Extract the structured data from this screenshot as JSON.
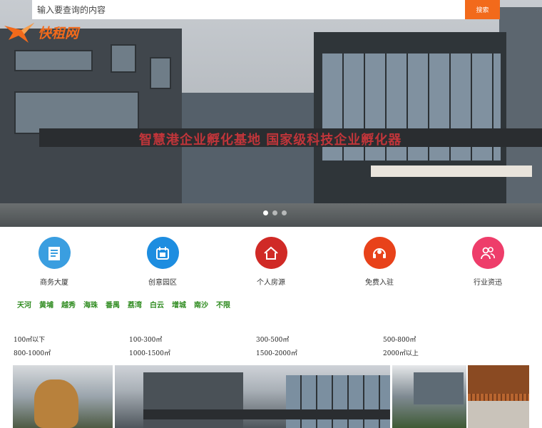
{
  "search": {
    "placeholder": "输入要查询的内容",
    "button_label": "搜索"
  },
  "logo": {
    "text": "快租网",
    "accent_color": "#f26a1b"
  },
  "hero": {
    "sign_text": "智慧港企业孵化基地  国家级科技企业孵化器"
  },
  "categories": [
    {
      "label": "商务大厦",
      "icon": "building-doc-icon",
      "color": "#3a9ee0"
    },
    {
      "label": "创意园区",
      "icon": "park-calendar-icon",
      "color": "#1d8de0"
    },
    {
      "label": "个人房源",
      "icon": "house-icon",
      "color": "#d02a26"
    },
    {
      "label": "免费入驻",
      "icon": "headset-icon",
      "color": "#e8421a"
    },
    {
      "label": "行业资迅",
      "icon": "people-icon",
      "color": "#ee3d6a"
    }
  ],
  "districts": [
    "天河",
    "黄埔",
    "越秀",
    "海珠",
    "番禺",
    "荔湾",
    "白云",
    "增城",
    "南沙",
    "不限"
  ],
  "sizes": [
    [
      "100㎡以下",
      "100-300㎡",
      "300-500㎡",
      "500-800㎡"
    ],
    [
      "800-1000㎡",
      "1000-1500㎡",
      "1500-2000㎡",
      "2000㎡以上"
    ]
  ]
}
